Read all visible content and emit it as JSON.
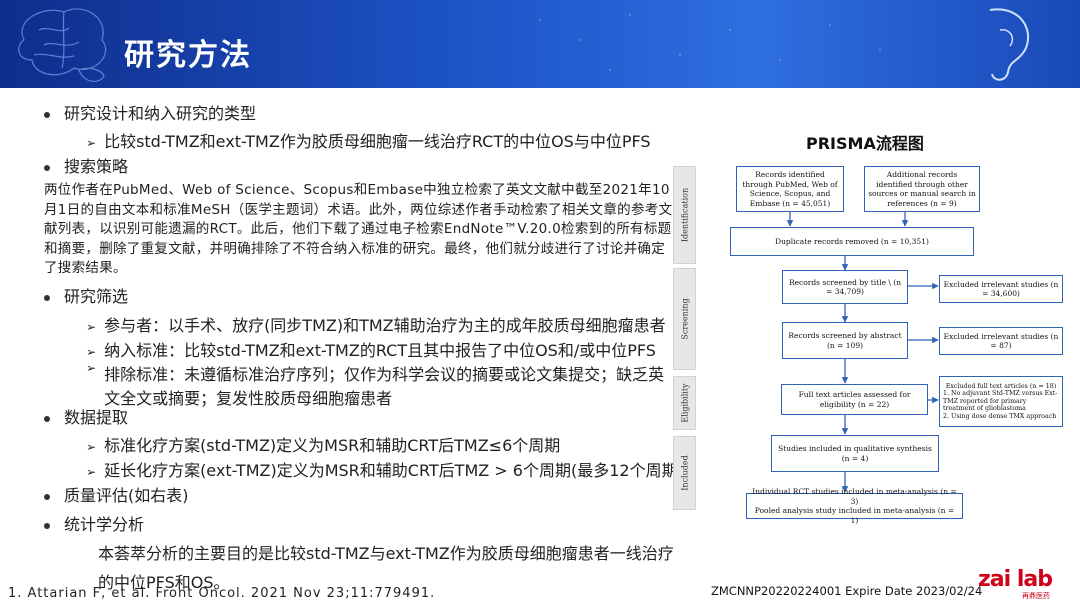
{
  "header": {
    "title": "研究方法"
  },
  "bullets": {
    "b1": "研究设计和纳入研究的类型",
    "b1_sub": "比较std-TMZ和ext-TMZ作为胶质母细胞瘤一线治疗RCT的中位OS与中位PFS",
    "b2": "搜索策略",
    "b2_para": "两位作者在PubMed、Web of Science、Scopus和Embase中独立检索了英文文献中截至2021年10月1日的自由文本和标准MeSH（医学主题词）术语。此外，两位综述作者手动检索了相关文章的参考文献列表，以识别可能遗漏的RCT。此后，他们下载了通过电子检索EndNote™V.20.0检索到的所有标题和摘要，删除了重复文献，并明确排除了不符合纳入标准的研究。最终，他们就分歧进行了讨论并确定了搜索结果。",
    "b3": "研究筛选",
    "b3_sub1": "参与者：以手术、放疗(同步TMZ)和TMZ辅助治疗为主的成年胶质母细胞瘤患者",
    "b3_sub2": "纳入标准：比较std-TMZ和ext-TMZ的RCT且其中报告了中位OS和/或中位PFS",
    "b3_sub3": "排除标准：未遵循标准治疗序列；仅作为科学会议的摘要或论文集提交；缺乏英文全文或摘要；复发性胶质母细胞瘤患者",
    "b4": "数据提取",
    "b4_sub1": "标准化疗方案(std-TMZ)定义为MSR和辅助CRT后TMZ≤6个周期",
    "b4_sub2": "延长化疗方案(ext-TMZ)定义为MSR和辅助CRT后TMZ > 6个周期(最多12个周期)",
    "b5": "质量评估(如右表)",
    "b6": "统计学分析",
    "b6_line1": "本荟萃分析的主要目的是比较std-TMZ与ext-TMZ作为胶质母细胞瘤患者一线治疗",
    "b6_line2": "的中位PFS和OS。"
  },
  "footer": {
    "reference": "1. Attarian F, et al. Front Oncol. 2021 Nov 23;11:779491.",
    "expire": "ZMCNNP20220224001 Expire Date 2023/02/24",
    "logo_text": "zai lab",
    "logo_sub": "再鼎医药"
  },
  "prisma": {
    "title": "PRISMA流程图",
    "stages": [
      "Identification",
      "Screening",
      "Eligibility",
      "Included"
    ],
    "identified": "Records identified through PubMed, Web of Science, Scopus, and Embase (n = 45,051)",
    "additional": "Additional records identified through other sources or manual search in references (n = 9)",
    "duplicates": "Duplicate records removed (n = 10,351)",
    "screened_title": "Records screened by title \\ (n = 34,709)",
    "excluded_title": "Excluded irrelevant studies (n = 34,600)",
    "screened_abstract": "Records screened by abstract (n = 109)",
    "excluded_abstract": "Excluded irrelevant studies (n = 87)",
    "fulltext": "Full text articles assessed for eligibility (n = 22)",
    "excluded_full_head": "Excluded full text articles (n = 18)",
    "excluded_full_1": "1.  No adjuvant Std-TMZ versus Ext-TMZ reported for primary treatment of glioblastoma",
    "excluded_full_2": "2.  Using dose dense TMX approach",
    "qualitative": "Studies included in qualitative synthesis (n = 4)",
    "meta1": "Individual RCT studies included in meta-analysis (n = 3)",
    "meta2": "Pooled analysis study included in meta-analysis (n = 1)"
  },
  "colors": {
    "banner": "#1e56c9",
    "box_border": "#2f62b8"
  }
}
